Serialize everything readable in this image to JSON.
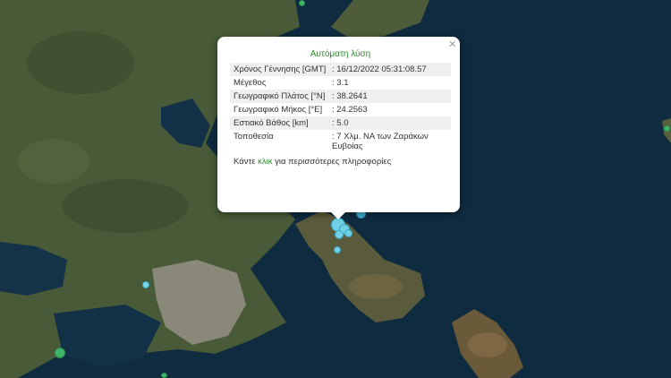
{
  "popup": {
    "title": "Αυτόματη λύση",
    "close_symbol": "×",
    "rows": [
      {
        "label": "Χρόνος Γέννησης [GMT]",
        "value": ": 16/12/2022 05:31:08.57"
      },
      {
        "label": "Μέγεθος",
        "value": ": 3.1"
      },
      {
        "label": "Γεωγραφικό Πλάτος [°N]",
        "value": ": 38.2641"
      },
      {
        "label": "Γεωγραφικό Μήκος [°E]",
        "value": ": 24.2563"
      },
      {
        "label": "Εστιακό Βάθος [km]",
        "value": ": 5.0"
      },
      {
        "label": "Τοποθεσία",
        "value": ": 7 Χλμ. ΝΑ των Ζαράκων Ευβοίας"
      }
    ],
    "more_prefix": "Κάντε ",
    "more_link": "κλικ",
    "more_suffix": " για περισσότερες πληροφορίες"
  },
  "colors": {
    "sea": "#0f2b3f",
    "land": "#4a5a38",
    "urban": "#8a8878",
    "marker_recent": "#7fd6e8",
    "marker_older": "#3fb56a",
    "popup_accent": "#2e8b2e"
  }
}
